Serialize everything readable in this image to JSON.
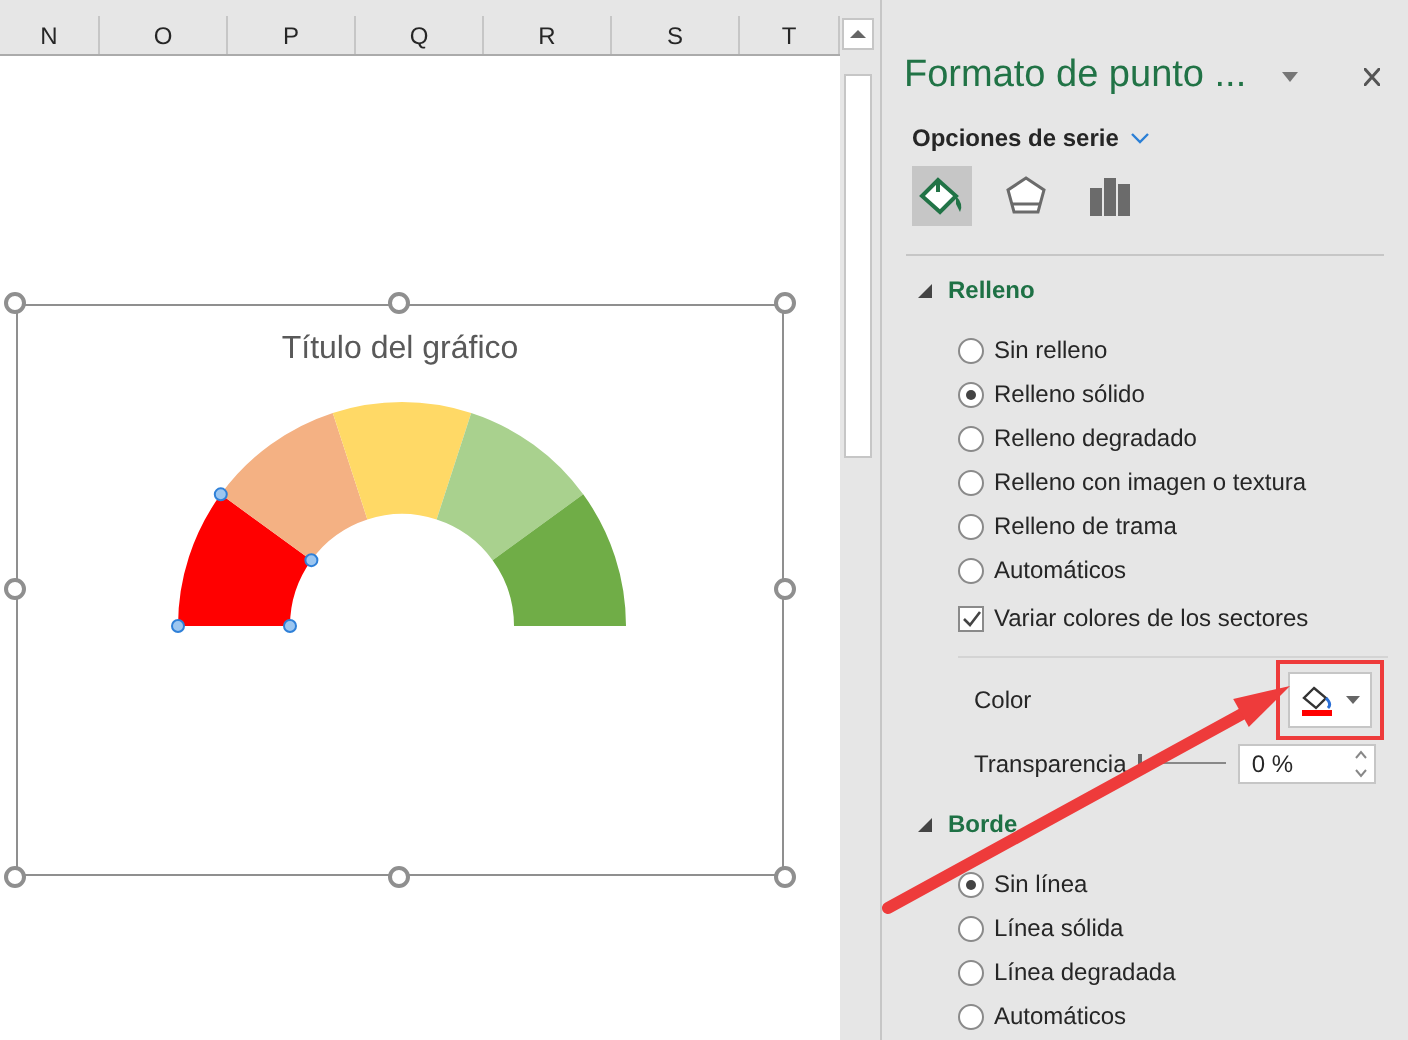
{
  "column_headers": [
    "N",
    "O",
    "P",
    "Q",
    "R",
    "S",
    "T"
  ],
  "chart": {
    "title": "Título del gráfico",
    "segments": [
      {
        "color": "#ff0000",
        "selected": true
      },
      {
        "color": "#f4b183",
        "selected": false
      },
      {
        "color": "#ffd966",
        "selected": false
      },
      {
        "color": "#a9d18e",
        "selected": false
      },
      {
        "color": "#70ad47",
        "selected": false
      }
    ]
  },
  "panel": {
    "title": "Formato de punto ...",
    "options_label": "Opciones de serie",
    "icon_tabs": [
      {
        "kind": "fill",
        "selected": true
      },
      {
        "kind": "effects",
        "selected": false
      },
      {
        "kind": "series",
        "selected": false
      }
    ],
    "sections": [
      {
        "title": "Relleno",
        "expanded": true,
        "options": [
          {
            "label": "Sin relleno",
            "selected": false
          },
          {
            "label": "Relleno sólido",
            "selected": true
          },
          {
            "label": "Relleno degradado",
            "selected": false
          },
          {
            "label": "Relleno con imagen o textura",
            "selected": false
          },
          {
            "label": "Relleno de trama",
            "selected": false
          },
          {
            "label": "Automáticos",
            "selected": false
          }
        ],
        "checkbox": {
          "label": "Variar colores de los sectores",
          "checked": true
        },
        "color": {
          "label": "Color"
        },
        "transparency": {
          "label": "Transparencia",
          "value": "0 %",
          "level": 0
        }
      },
      {
        "title": "Borde",
        "expanded": true,
        "options": [
          {
            "label": "Sin línea",
            "selected": true
          },
          {
            "label": "Línea sólida",
            "selected": false
          },
          {
            "label": "Línea degradada",
            "selected": false
          },
          {
            "label": "Automáticos",
            "selected": false
          }
        ]
      }
    ]
  }
}
